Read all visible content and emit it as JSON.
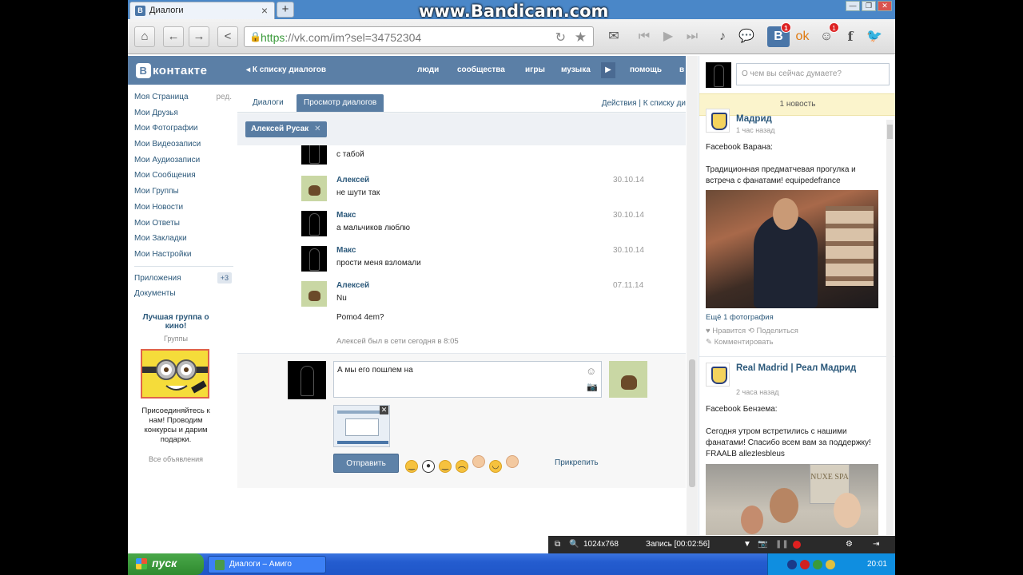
{
  "watermark": "www.Bandicam.com",
  "browser": {
    "tab_title": "Диалоги",
    "url_scheme": "https",
    "url_rest": "://vk.com/im?sel=34752304",
    "vk_badge": "1",
    "people_badge": "1"
  },
  "vk": {
    "logo": "контакте",
    "logo_letter": "В",
    "back_link": "К списку диалогов",
    "nav": [
      "люди",
      "сообщества",
      "игры",
      "музыка",
      "помощь",
      "в"
    ]
  },
  "left_menu": {
    "items": [
      "Моя Страница",
      "Мои Друзья",
      "Мои Фотографии",
      "Мои Видеозаписи",
      "Мои Аудиозаписи",
      "Мои Сообщения",
      "Мои Группы",
      "Мои Новости",
      "Мои Ответы",
      "Мои Закладки",
      "Мои Настройки"
    ],
    "edit_label": "ред.",
    "apps": "Приложения",
    "apps_badge": "+3",
    "docs": "Документы"
  },
  "ad": {
    "title": "Лучшая группа о кино!",
    "subtitle": "Группы",
    "text": "Присоединяйтесь к нам! Проводим конкурсы и дарим подарки.",
    "all_ads": "Все объявления"
  },
  "dialogs": {
    "tab_dialogs": "Диалоги",
    "tab_view": "Просмотр диалогов",
    "actions": "Действия",
    "actions_sep": "|",
    "actions_back": "К списку ди",
    "peer_name": "Алексей Русак",
    "partial_top_text": "с табой",
    "messages": [
      {
        "name": "Алексей",
        "text": "не шути так",
        "date": "30.10.14"
      },
      {
        "name": "Макс",
        "text": "а мальчиков люблю",
        "date": "30.10.14"
      },
      {
        "name": "Макс",
        "text": "прости меня взломали",
        "date": "30.10.14"
      },
      {
        "name": "Алексей",
        "text": "Nu",
        "text2": "Pomo4 4em?",
        "date": "07.11.14"
      }
    ],
    "online_status": "Алексей был в сети сегодня в 8:05",
    "composer_text": "А мы его пошлем на",
    "send_label": "Отправить",
    "attach_label": "Прикрепить"
  },
  "feed": {
    "status_placeholder": "О чем вы сейчас думаете?",
    "news_count": "1 новость",
    "post1": {
      "title": "Мадрид",
      "time": "1 час назад",
      "author": "Facebook Варана:",
      "text": "Традиционная предматчевая прогулка и встреча с фанатами! equipedefrance",
      "more_photos": "Ещё 1 фотография",
      "like": "Нравится",
      "share": "Поделиться",
      "comment": "Комментировать"
    },
    "post2": {
      "title": "Real Madrid | Реал Мадрид",
      "time": "2 часа назад",
      "author": "Facebook Бензема:",
      "text": "Сегодня утром встретились с нашими фанатами! Спасибо всем вам за поддержку! FRAALB allezlesbleus",
      "sign_text": "NUXE SPA"
    }
  },
  "recorder": {
    "resolution": "1024x768",
    "record_label": "Запись [00:02:56]"
  },
  "taskbar": {
    "start": "пуск",
    "task": "Диалоги – Амиго",
    "lang": "RU",
    "clock": "20:01"
  }
}
